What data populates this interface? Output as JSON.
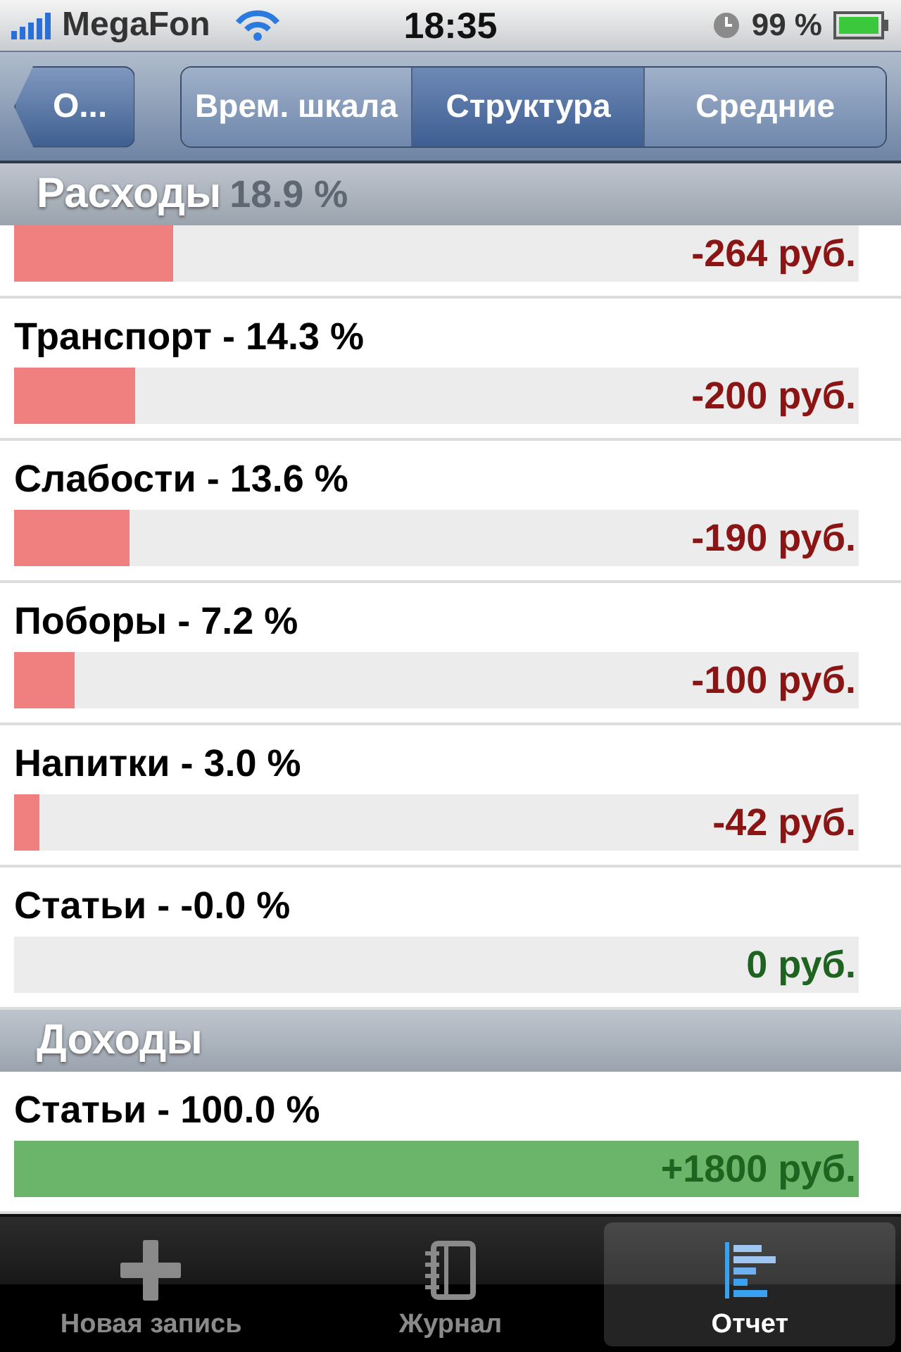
{
  "status_bar": {
    "carrier": "MegaFon",
    "time": "18:35",
    "battery": "99 %"
  },
  "nav": {
    "back": "О...",
    "segments": [
      {
        "label": "Врем. шкала",
        "selected": false
      },
      {
        "label": "Структура",
        "selected": true
      },
      {
        "label": "Средние",
        "selected": false
      }
    ]
  },
  "sections": [
    {
      "title": "Расходы",
      "covered_text": "18.9 %",
      "rows": [
        {
          "kind": "negative",
          "level": 0.188,
          "amount": "-264 руб."
        },
        {
          "label": "Транспорт - 14.3 %",
          "kind": "negative",
          "level": 0.143,
          "amount": "-200 руб."
        },
        {
          "label": "Слабости - 13.6 %",
          "kind": "negative",
          "level": 0.137,
          "amount": "-190 руб."
        },
        {
          "label": "Поборы - 7.2 %",
          "kind": "negative",
          "level": 0.072,
          "amount": "-100 руб."
        },
        {
          "label": "Напитки - 3.0 %",
          "kind": "negative",
          "level": 0.03,
          "amount": "-42 руб."
        },
        {
          "label": "Статьи - -0.0 %",
          "kind": "zero",
          "level": 0,
          "amount": "0 руб."
        }
      ]
    },
    {
      "title": "Доходы",
      "rows": [
        {
          "label": "Статьи - 100.0 %",
          "kind": "positive",
          "level": 1,
          "amount": "+1800 руб."
        }
      ]
    }
  ],
  "tab_bar": [
    {
      "label": "Новая запись",
      "selected": false
    },
    {
      "label": "Журнал",
      "selected": false
    },
    {
      "label": "Отчет",
      "selected": true
    }
  ]
}
